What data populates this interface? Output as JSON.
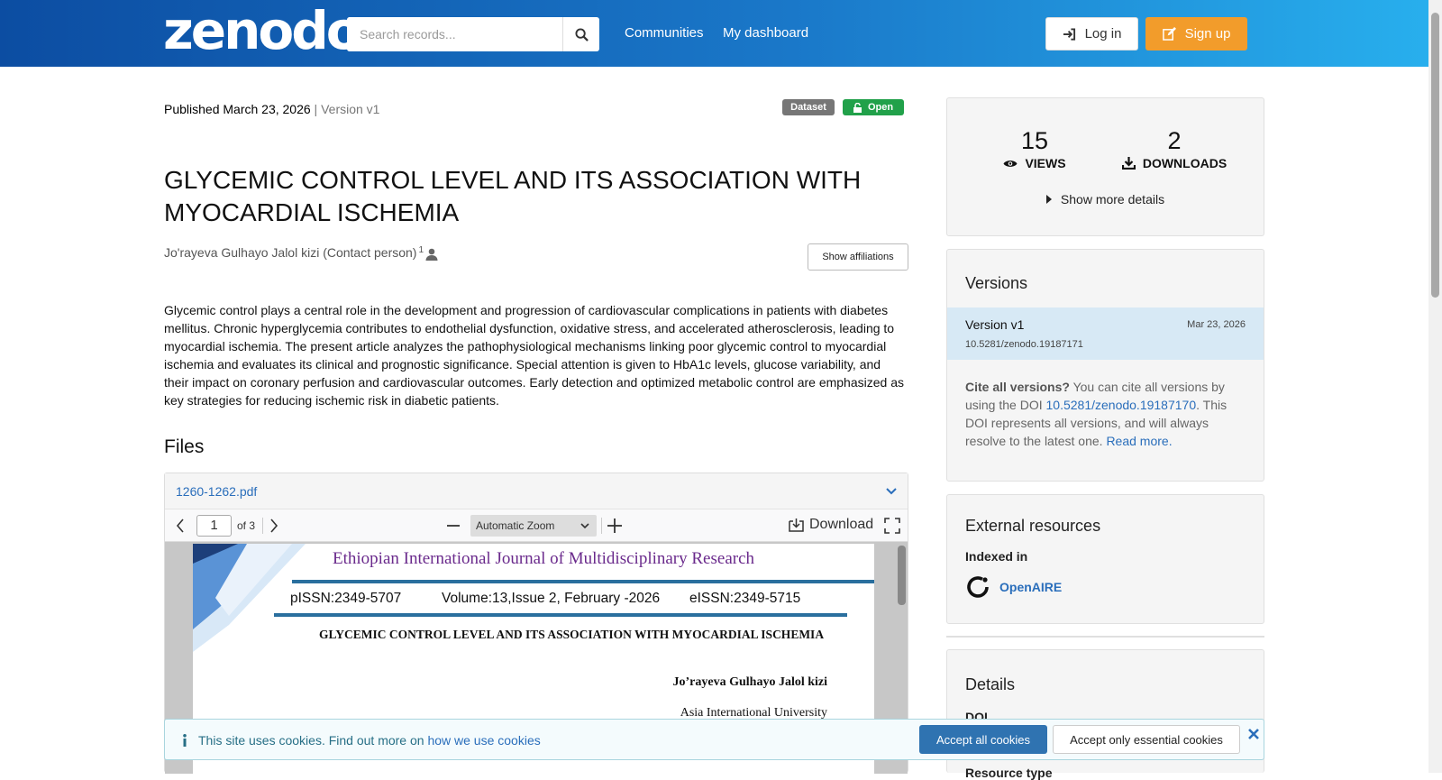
{
  "header": {
    "logo": "zenodo",
    "search_placeholder": "Search records...",
    "nav": [
      "Communities",
      "My dashboard"
    ],
    "login": "Log in",
    "signup": "Sign up"
  },
  "record": {
    "published": "Published March 23, 2026",
    "version_sep": " | Version v1",
    "badge_type": "Dataset",
    "badge_access": "Open",
    "title": "GLYCEMIC CONTROL LEVEL AND ITS ASSOCIATION WITH MYOCARDIAL ISCHEMIA",
    "author": "Jo'rayeva Gulhayo Jalol kizi (Contact person)",
    "author_sup": "1",
    "show_affiliations": "Show affiliations",
    "abstract": "Glycemic control plays a central role in the development and progression of cardiovascular complications in patients with diabetes mellitus. Chronic hyperglycemia contributes to endothelial dysfunction, oxidative stress, and accelerated atherosclerosis, leading to myocardial ischemia. The present article analyzes the pathophysiological mechanisms linking poor glycemic control to myocardial ischemia and evaluates its clinical and prognostic significance. Special attention is given to HbA1c levels, glucose variability, and their impact on coronary perfusion and cardiovascular outcomes. Early detection and optimized metabolic control are emphasized as key strategies for reducing ischemic risk in diabetic patients."
  },
  "files": {
    "heading": "Files",
    "filename": "1260-1262.pdf",
    "page": "1",
    "page_of": "of 3",
    "zoom": "Automatic Zoom",
    "download": "Download",
    "pdf": {
      "journal": "Ethiopian International Journal of Multidisciplinary Research",
      "pissn": "pISSN:2349-5707",
      "volume": "Volume:13,Issue 2, February -2026",
      "eissn": "eISSN:2349-5715",
      "title": "GLYCEMIC CONTROL LEVEL AND ITS ASSOCIATION WITH MYOCARDIAL ISCHEMIA",
      "author": "Jo’rayeva Gulhayo Jalol kizi",
      "university": "Asia International University"
    }
  },
  "stats": {
    "views": "15",
    "views_label": "VIEWS",
    "downloads": "2",
    "downloads_label": "DOWNLOADS",
    "more": "Show more details"
  },
  "versions": {
    "heading": "Versions",
    "label": "Version v1",
    "date": "Mar 23, 2026",
    "doi": "10.5281/zenodo.19187171",
    "cite_bold": "Cite all versions?",
    "cite_text": " You can cite all versions by using the DOI ",
    "cite_doi": "10.5281/zenodo.19187170",
    "cite_text2": ". This DOI represents all versions, and will always resolve to the latest one. ",
    "read_more": "Read more."
  },
  "external": {
    "heading": "External resources",
    "indexed": "Indexed in",
    "openaire": "OpenAIRE"
  },
  "details": {
    "heading": "Details",
    "doi_label": "DOI",
    "resource_type_label": "Resource type"
  },
  "cookie": {
    "text": "This site uses cookies. Find out more on ",
    "link": "how we use cookies",
    "accept_all": "Accept all cookies",
    "accept_essential": "Accept only essential cookies"
  },
  "colors": {
    "accent": "#f29c2b",
    "link": "#2a6ebb",
    "open_badge": "#21a14a",
    "dataset_badge": "#767676"
  }
}
